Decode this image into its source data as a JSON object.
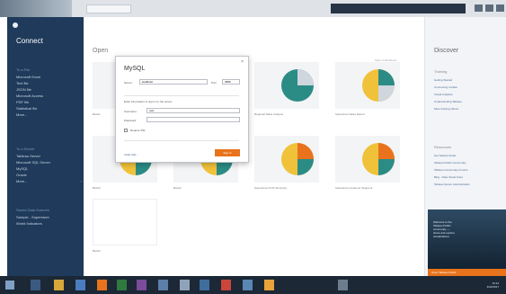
{
  "app": {
    "accent": "#e8731c",
    "sidebar_bg": "#1f3a5a"
  },
  "sidebar": {
    "title": "Connect",
    "file_heading": "To a File",
    "file_items": [
      "Microsoft Excel",
      "Text file",
      "JSON file",
      "Microsoft Access",
      "PDF file",
      "Statistical file",
      "More..."
    ],
    "server_heading": "To a Server",
    "server_items": [
      "Tableau Server",
      "Microsoft SQL Server",
      "MySQL",
      "Oracle",
      "More..."
    ],
    "saved_heading": "Saved Data Sources",
    "saved_items": [
      "Sample - Superstore",
      "World Indicators"
    ]
  },
  "main": {
    "heading": "Open",
    "link_text": "Open a Workbook",
    "thumbs": [
      {
        "caption": "Book1"
      },
      {
        "caption": ""
      },
      {
        "caption": "Regional Sales Analysis"
      },
      {
        "caption": "Superstore Sales Report"
      },
      {
        "caption": "Book3"
      },
      {
        "caption": "Book2"
      },
      {
        "caption": "Superstore Profit Summary"
      },
      {
        "caption": "Superstore Customer Segment"
      },
      {
        "caption": "Book4"
      }
    ]
  },
  "dialog": {
    "title": "MySQL",
    "close": "×",
    "server_label": "Server:",
    "server_value": "localhost",
    "port_label": "Port:",
    "port_value": "3306",
    "section_label": "Enter information to sign in to the server:",
    "username_label": "Username:",
    "username_value": "root",
    "password_label": "Password:",
    "password_value": "",
    "ssl_label": "Require SSL",
    "initial_sql": "Initial SQL...",
    "signin_label": "Sign In"
  },
  "discover": {
    "title": "Discover",
    "training_heading": "Training",
    "training_items": [
      "Getting Started",
      "Connecting to Data",
      "Visual Analytics",
      "Understanding Tableau",
      "More training videos"
    ],
    "resources_heading": "Resources",
    "resources_items": [
      "Get Started Guide",
      "Tableau Public Community",
      "Tableau Community Forums",
      "Blog - Data Visual Index",
      "Tableau Server Administration"
    ],
    "ad_lines": [
      "Welcome to the",
      "Tableau Public",
      "community —",
      "share and explore",
      "visualizations"
    ],
    "ad_button": "Open Tableau Public"
  },
  "taskbar": {
    "time": "10:12",
    "date": "4/22/2017"
  }
}
